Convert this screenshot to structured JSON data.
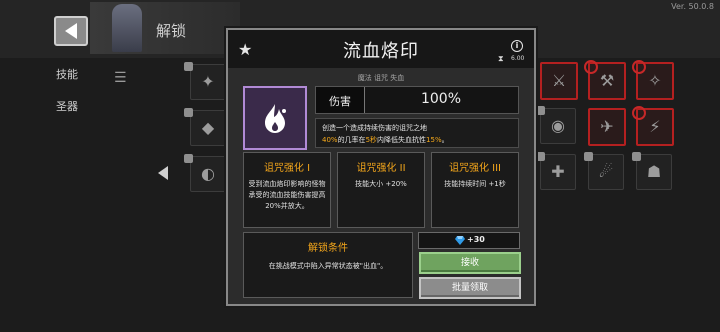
{
  "background": {
    "title": "解锁",
    "version": "Ver. 50.0.8",
    "side_tabs": [
      "技能",
      "圣器"
    ]
  },
  "modal": {
    "title": "流血烙印",
    "small_number": "6.00",
    "tags": "魔法  诅咒  失血",
    "stat": {
      "label": "伤害",
      "value": "100%"
    },
    "description": {
      "line1": "创造一个造成持续伤害的诅咒之地",
      "line2_parts": [
        "40%",
        "的几率在",
        "5秒",
        "内降低失血抗性",
        "15%",
        "。"
      ]
    },
    "curses": [
      {
        "title": "诅咒强化 I",
        "body": "受到流血烙印影响的怪物承受的流血技能伤害提高20%并放大。"
      },
      {
        "title": "诅咒强化 II",
        "body": "技能大小 +20%"
      },
      {
        "title": "诅咒强化 III",
        "body": "技能持续时间 +1秒"
      }
    ],
    "unlock": {
      "title": "解锁条件",
      "body": "在挑战模式中陷入异常状态被\"出血\"。"
    },
    "reward": {
      "amount": "+30"
    },
    "claim_label": "接收",
    "batch_label": "批量领取"
  },
  "colors": {
    "accent_orange": "#f2a51b",
    "claim_green": "#6fa35f",
    "icon_purple": "#b18ad6",
    "gem_blue": "#2f9be8"
  }
}
